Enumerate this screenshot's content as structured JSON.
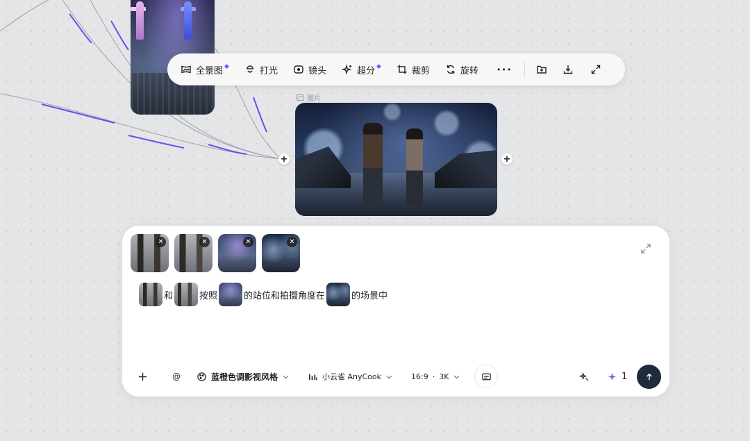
{
  "canvas": {
    "node_label": "图片"
  },
  "toolbar": {
    "items": [
      {
        "label": "全景图",
        "icon": "panorama-icon",
        "premium": true
      },
      {
        "label": "打光",
        "icon": "light-icon",
        "premium": false
      },
      {
        "label": "镜头",
        "icon": "lens-icon",
        "premium": false
      },
      {
        "label": "超分",
        "icon": "sparkle-icon",
        "premium": true
      },
      {
        "label": "裁剪",
        "icon": "crop-icon",
        "premium": false
      },
      {
        "label": "旋转",
        "icon": "rotate-icon",
        "premium": false
      }
    ],
    "more": "•••",
    "gem": "◆"
  },
  "prompt": {
    "word_and": "和",
    "word_follow": "按照",
    "word_pose": "的站位和拍摄角度在",
    "word_scene": "的场景中"
  },
  "controls": {
    "mention": "@",
    "style": "蓝橙色调影视风格",
    "model": "小云雀 AnyCook",
    "ratio": "16:9",
    "dot": "·",
    "resolution": "3K",
    "credits": "1",
    "thumb_close": "✕",
    "plus": "+"
  },
  "colors": {
    "accent": "#7c56f2",
    "wire_purple": "#6a4ff0",
    "send_bg": "#1f2a3c"
  }
}
